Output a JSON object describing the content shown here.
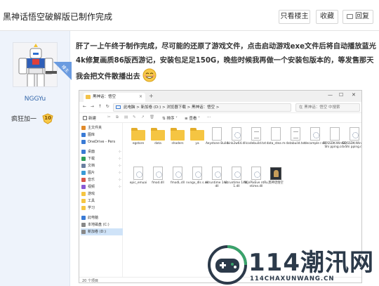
{
  "header": {
    "title": "黑神话悟空破解版已制作完成",
    "buttons": {
      "author_only": "只看楼主",
      "favorite": "收藏",
      "reply": "回复"
    }
  },
  "author": {
    "username": "NGGYu",
    "op_badge": "楼主",
    "rank_title": "疯狂加一",
    "rank_level": "10"
  },
  "post": {
    "body": "肝了一上午终于制作完成，尽可能的还原了游戏文件，点击启动游戏exe文件后将自动播放蓝光4k修复画质86版西游记，安装包足足150G，晚些时候我再做一个安装包版本的，等发售那天我会把文件散播出去"
  },
  "explorer": {
    "tab_title": "黑神话：悟空",
    "address": "此电脑  >  新加卷 (D:)  >  浏览器下载  >  黑神话：悟空  >",
    "search_placeholder": "在 黑神话：悟空 中搜索",
    "commands": {
      "new": "新建",
      "sort": "排序",
      "view": "查看"
    },
    "nav": [
      {
        "label": "主文件夹",
        "icon": "home-icon"
      },
      {
        "label": "图库",
        "icon": "gallery-icon"
      },
      {
        "label": "OneDrive - Pers",
        "icon": "cloud-icon"
      },
      {
        "label": "桌面",
        "icon": "desktop-icon"
      },
      {
        "label": "下载",
        "icon": "download-icon"
      },
      {
        "label": "文档",
        "icon": "document-icon"
      },
      {
        "label": "图片",
        "icon": "picture-icon"
      },
      {
        "label": "音乐",
        "icon": "music-icon"
      },
      {
        "label": "视频",
        "icon": "video-icon"
      },
      {
        "label": "游戏",
        "icon": "folder-icon"
      },
      {
        "label": "工具",
        "icon": "folder-icon"
      },
      {
        "label": "学习",
        "icon": "folder-icon"
      },
      {
        "label": "此电脑",
        "icon": "pc-icon"
      },
      {
        "label": "本地磁盘 (C:)",
        "icon": "drive-icon"
      },
      {
        "label": "新加卷 (D:)",
        "icon": "drive-icon"
      }
    ],
    "files": [
      {
        "name": "egstore",
        "type": "folder"
      },
      {
        "name": "data",
        "type": "folder"
      },
      {
        "name": "shaders",
        "type": "folder"
      },
      {
        "name": "ya",
        "type": "folder"
      },
      {
        "name": "Aeystone Build",
        "type": "doc"
      },
      {
        "name": "bink2w64.dll",
        "type": "dll"
      },
      {
        "name": "codebuild.txt",
        "type": "txt"
      },
      {
        "name": "data_stea m",
        "type": "doc"
      },
      {
        "name": "databuild.txt",
        "type": "txt"
      },
      {
        "name": "decomple r.dll",
        "type": "dll"
      },
      {
        "name": "EOSSDK-Win64-Shi pping.cdx",
        "type": "doc"
      },
      {
        "name": "EOSSDK-Win64-Shi pping.dll",
        "type": "dll"
      },
      {
        "name": "epic_emuai",
        "type": "dll"
      },
      {
        "name": "fmod.dll",
        "type": "dll"
      },
      {
        "name": "fmodL.dll",
        "type": "dll"
      },
      {
        "name": "nvngx_dls s.dll",
        "type": "dll"
      },
      {
        "name": "vcruntime 140.dll",
        "type": "dll"
      },
      {
        "name": "vcruntime 140_1.dll",
        "type": "dll"
      },
      {
        "name": "WinPixEve ntRuntime.dll",
        "type": "dll"
      },
      {
        "name": "黑神话悟空",
        "type": "exe"
      }
    ],
    "status": "20 个项目"
  },
  "watermark": {
    "title": "114潮汛网",
    "url": "114CHAXUNWANG.CN"
  },
  "colors": {
    "sidebar_bg": "#eef3fb",
    "op_badge": "#6a9be0",
    "folder": "#f5c542",
    "watermark": "#2c3a4a",
    "watermark_accent": "#3aa36b"
  }
}
